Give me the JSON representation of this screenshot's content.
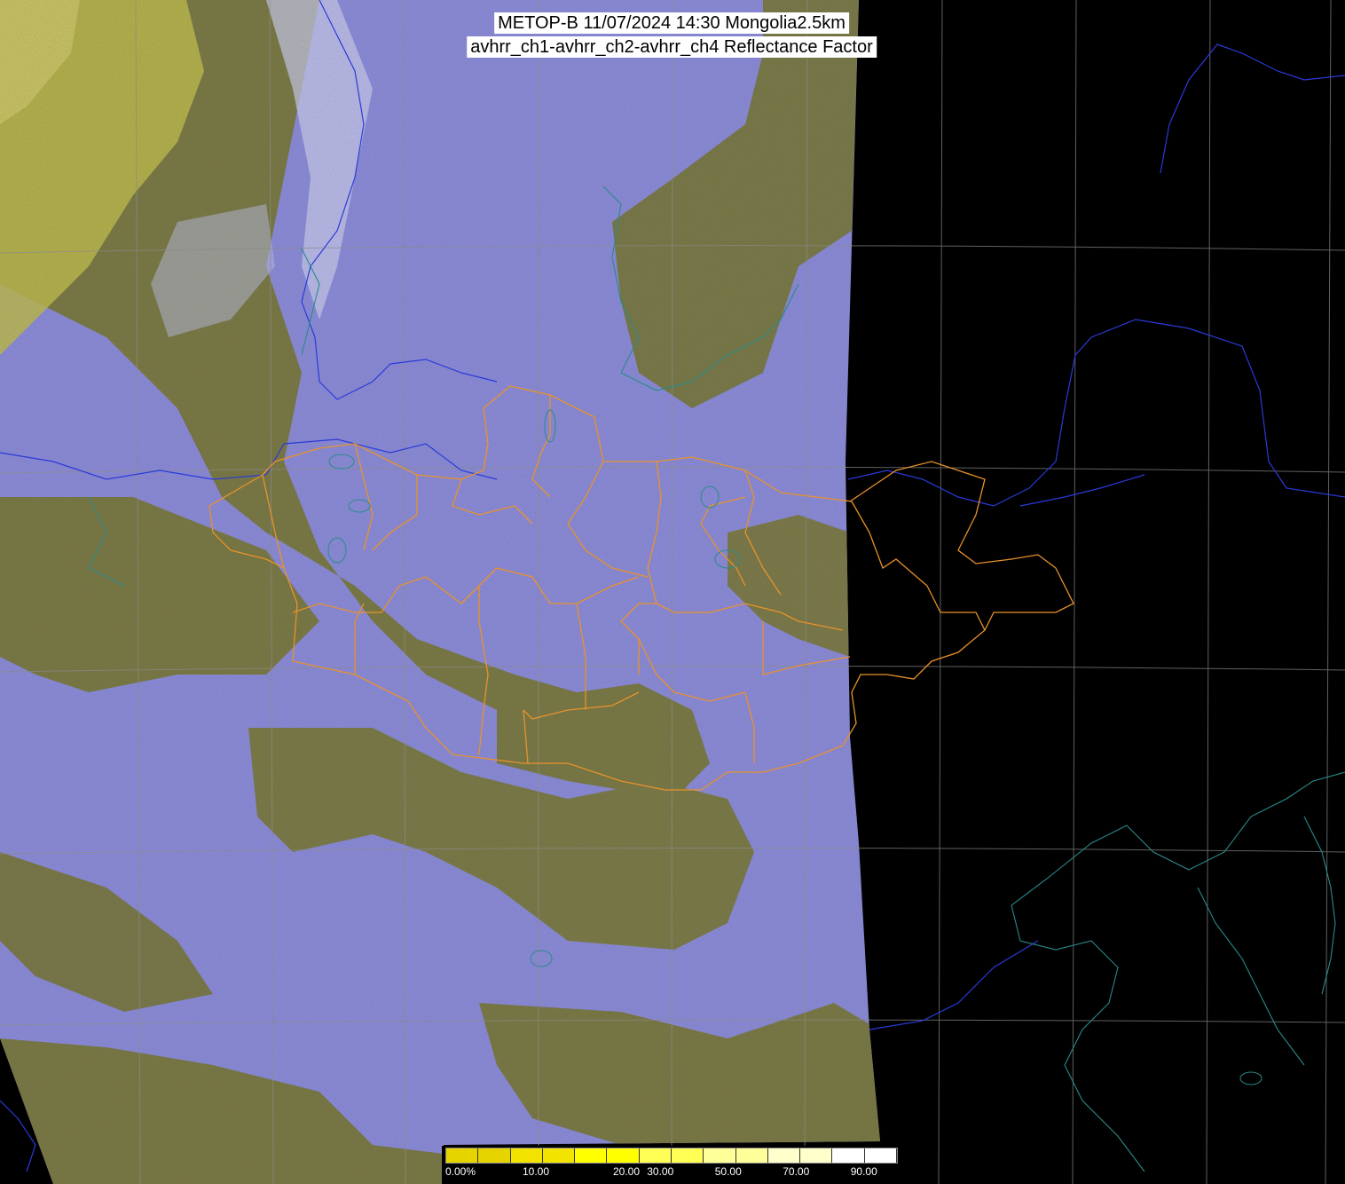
{
  "title": {
    "line1": "METOP-B 11/07/2024 14:30 Mongolia2.5km",
    "line2": "avhrr_ch1-avhrr_ch2-avhrr_ch4 Reflectance Factor"
  },
  "colorbar": {
    "ticks": [
      "0.00%",
      "10.00",
      "20.00",
      "30.00",
      "50.00",
      "70.00",
      "90.00"
    ],
    "tick_values": [
      0,
      10,
      20,
      30,
      50,
      70,
      90
    ],
    "colors": [
      "#e6d400",
      "#f2e400",
      "#ffff00",
      "#ffff55",
      "#ffff99",
      "#ffffcc",
      "#ffffff"
    ]
  },
  "colors": {
    "background": "#000000",
    "land_olive": "#7d7a2e",
    "cloud_lavender": "#9a9ae8",
    "boundary_orange": "#e8922a",
    "border_blue": "#2a3ad8",
    "coast_teal": "#2a7a8a",
    "grid": "#888888"
  }
}
